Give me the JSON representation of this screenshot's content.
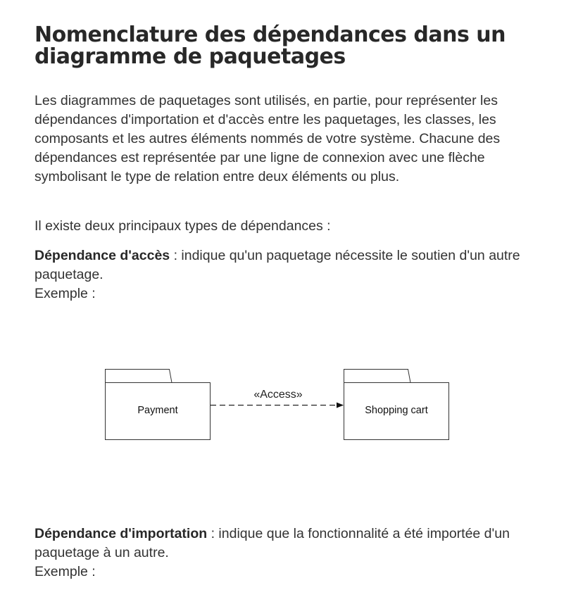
{
  "title": "Nomenclature des dépendances dans un diagramme de paquetages",
  "intro": "Les diagrammes de paquetages sont utilisés, en partie, pour représenter les dépendances d'importation et d'accès entre les paquetages, les classes, les composants et les autres éléments nommés de votre système. Chacune des dépendances est représentée par une ligne de connexion avec une flèche symbolisant le type de relation entre deux éléments ou plus.",
  "types_intro": "Il existe deux principaux types de dépendances :",
  "access_dependency": {
    "term": "Dépendance d'accès",
    "description": " : indique qu'un paquetage nécessite le soutien d'un autre paquetage.",
    "example_label": "Exemple :"
  },
  "access_diagram": {
    "source_package": "Payment",
    "target_package": "Shopping cart",
    "stereotype": "«Access»"
  },
  "import_dependency": {
    "term": "Dépendance d'importation",
    "description": " : indique que la fonctionnalité a été importée d'un paquetage à un autre.",
    "example_label": "Exemple :"
  }
}
